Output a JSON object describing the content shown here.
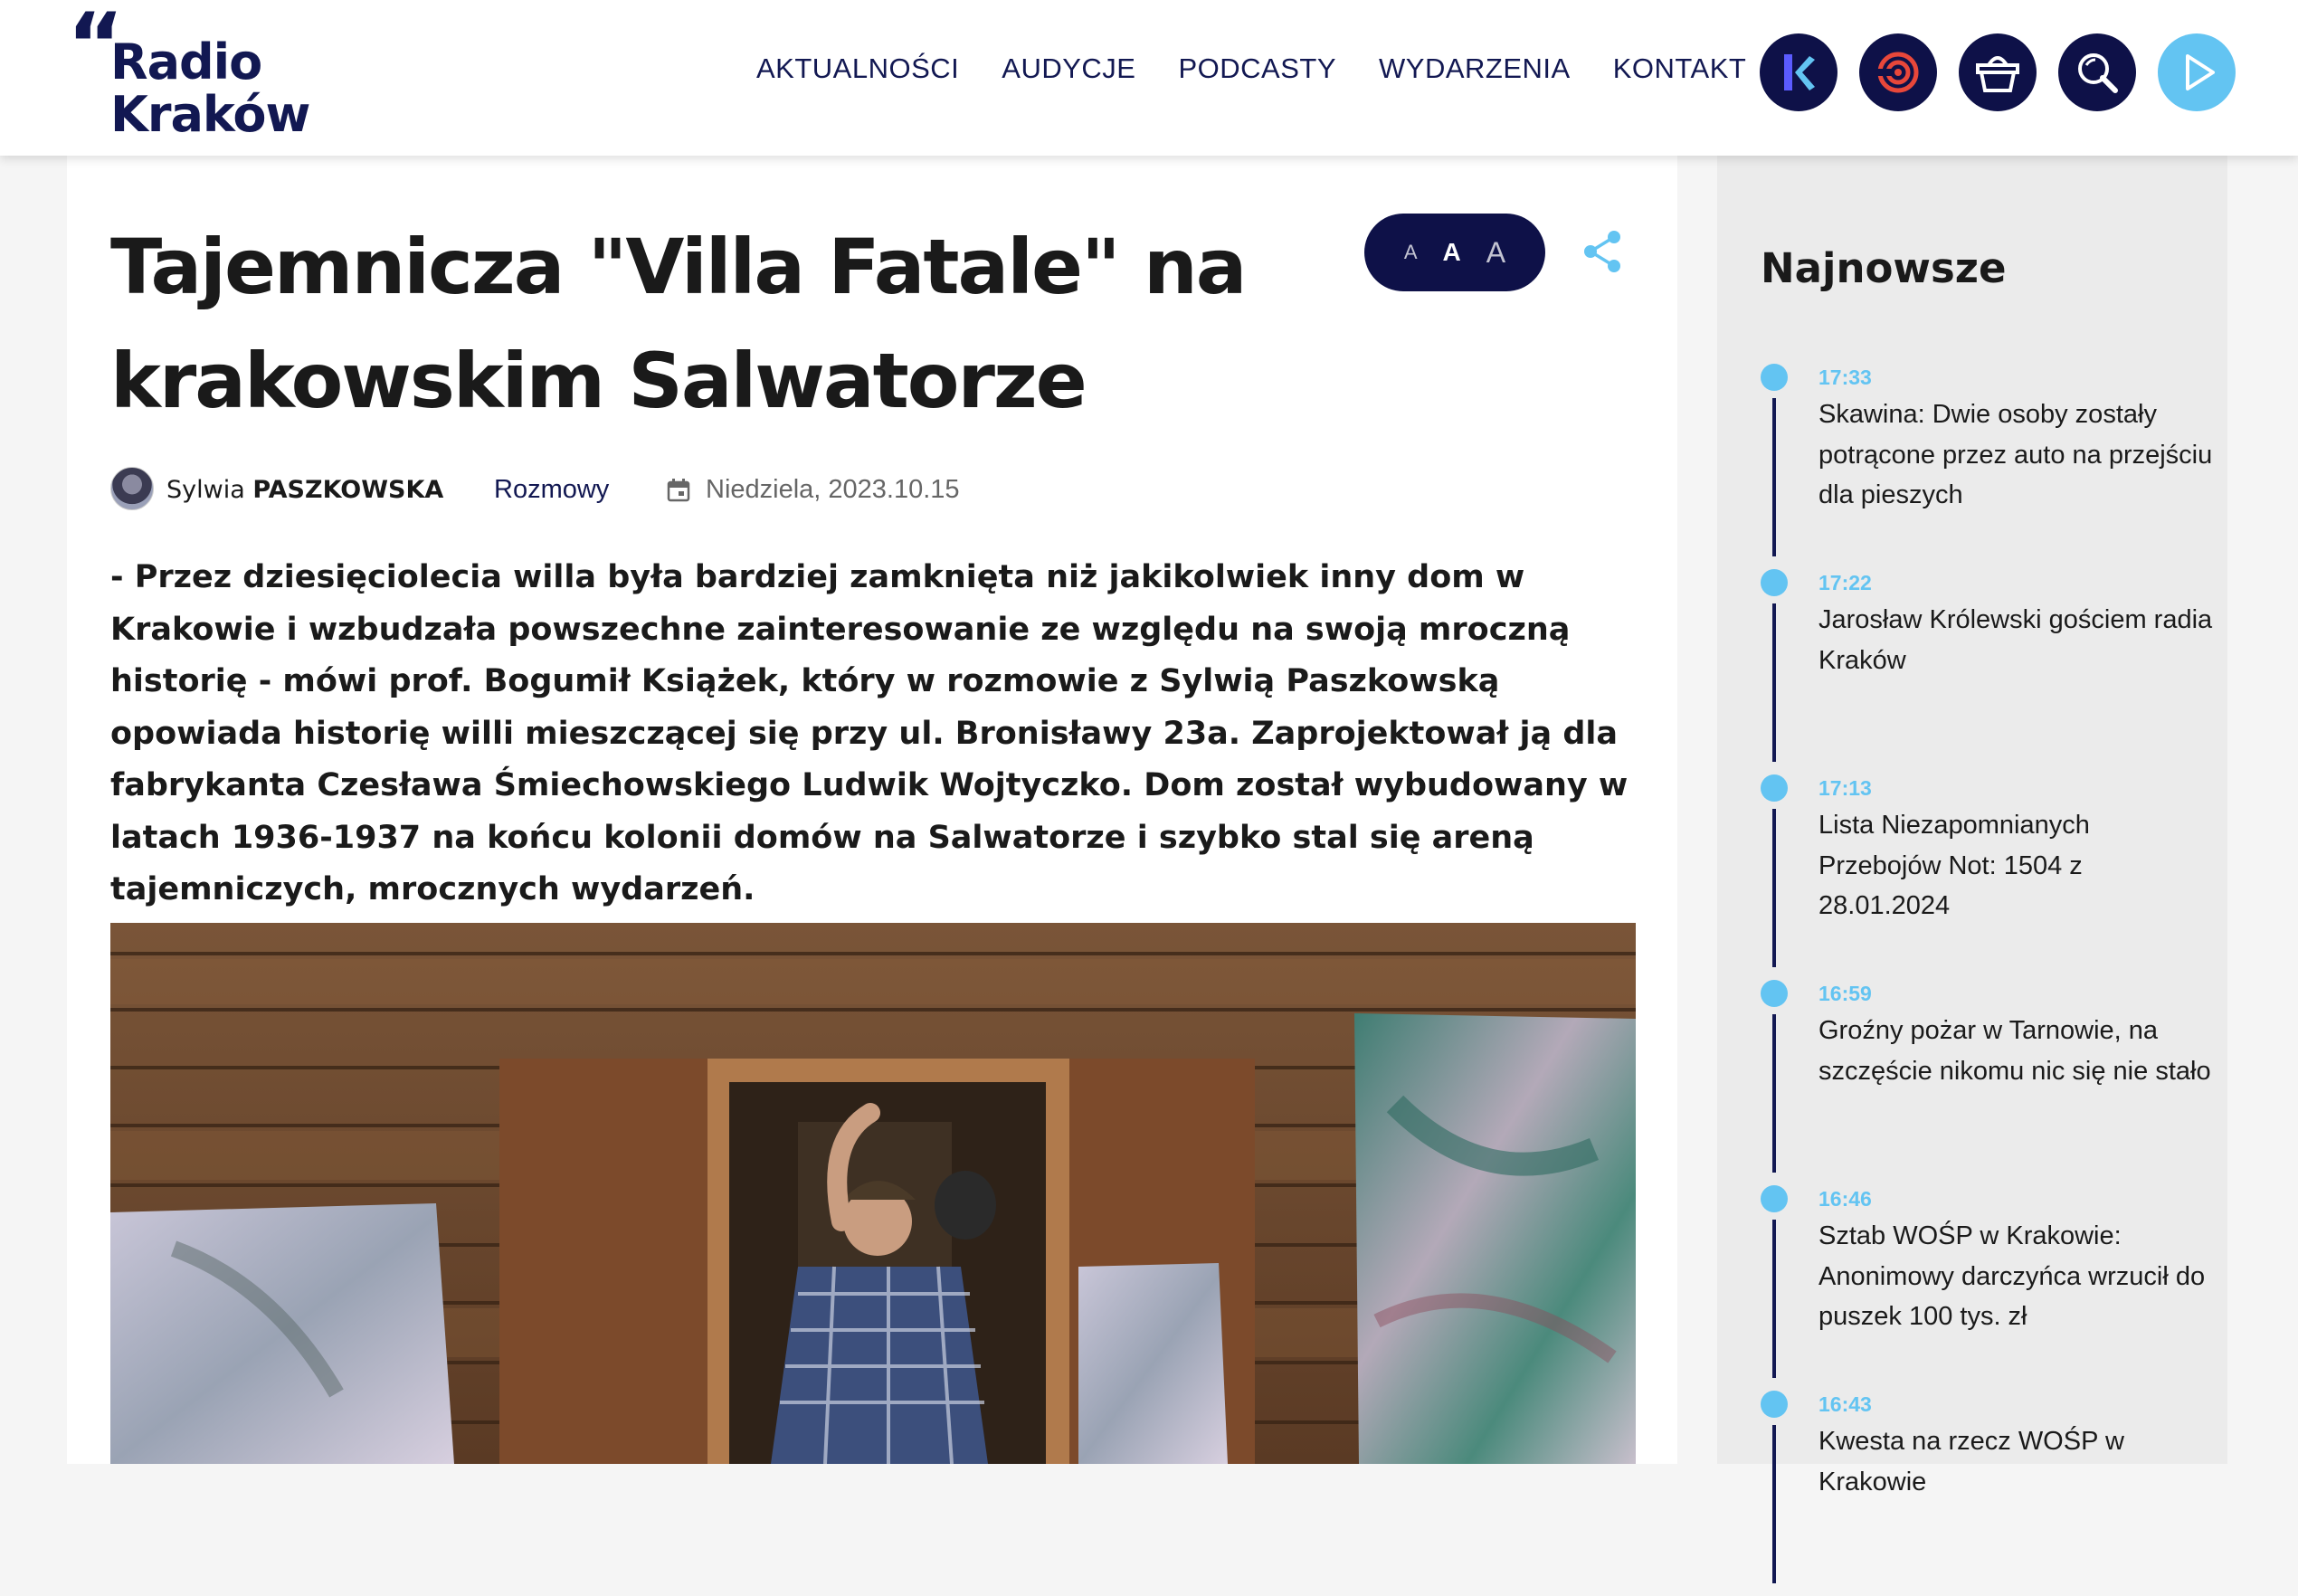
{
  "header": {
    "logo": {
      "line1": "Radio",
      "line2": "Kraków"
    },
    "nav": [
      "AKTUALNOŚCI",
      "AUDYCJE",
      "PODCASTY",
      "WYDARZENIA",
      "KONTAKT"
    ]
  },
  "article": {
    "title": "Tajemnicza \"Villa Fatale\" na krakowskim Salwatorze",
    "font_size_buttons": [
      "A",
      "A",
      "A"
    ],
    "author_first": "Sylwia",
    "author_last": "PASZKOWSKA",
    "category": "Rozmowy",
    "date": "Niedziela, 2023.10.15",
    "lead": "- Przez dziesięciolecia willa była bardziej zamknięta niż jakikolwiek inny dom w Krakowie i wzbudzała powszechne zainteresowanie ze względu na swoją mroczną historię - mówi prof. Bogumił Książek, który w rozmowie z Sylwią Paszkowską opowiada historię willi mieszczącej się przy ul. Bronisławy 23a. Zaprojektował ją dla fabrykanta Czesława Śmiechowskiego Ludwik Wojtyczko. Dom został wybudowany w latach 1936-1937 na końcu kolonii domów na Salwatorze i szybko stal się areną tajemniczych, mrocznych wydarzeń."
  },
  "sidebar": {
    "title": "Najnowsze",
    "items": [
      {
        "time": "17:33",
        "headline": "Skawina: Dwie osoby zostały potrącone przez auto na przejściu dla pieszych"
      },
      {
        "time": "17:22",
        "headline": "Jarosław Królewski gościem radia Kraków"
      },
      {
        "time": "17:13",
        "headline": "Lista Niezapomnianych Przebojów Not: 1504 z 28.01.2024"
      },
      {
        "time": "16:59",
        "headline": "Groźny pożar w Tarnowie, na szczęście nikomu nic się nie stało"
      },
      {
        "time": "16:46",
        "headline": "Sztab WOŚP w Krakowie: Anonimowy darczyńca wrzucił do puszek 100 tys. zł"
      },
      {
        "time": "16:43",
        "headline": "Kwesta na rzecz WOŚP w Krakowie"
      }
    ]
  },
  "colors": {
    "navy": "#121852",
    "dark_button": "#0e1148",
    "accent_blue": "#63c4f2",
    "sidebar_bg": "#ebebeb"
  },
  "icons": [
    "radio-krakow-k-icon",
    "music-player-icon",
    "shop-basket-icon",
    "search-icon",
    "play-icon",
    "share-icon",
    "calendar-icon"
  ]
}
